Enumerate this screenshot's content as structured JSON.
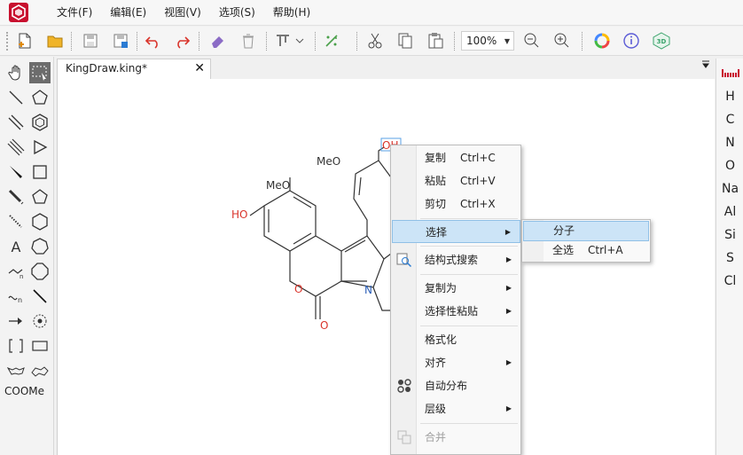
{
  "menubar": {
    "items": [
      "文件(F)",
      "编辑(E)",
      "视图(V)",
      "选项(S)",
      "帮助(H)"
    ]
  },
  "toolbar": {
    "zoom_value": "100%",
    "icons": [
      "new-file",
      "open-folder",
      "save",
      "save-as",
      "undo",
      "redo",
      "eraser",
      "delete",
      "align",
      "clean-structure",
      "cut",
      "copy",
      "paste",
      "zoom-out",
      "zoom-in",
      "color-wheel",
      "info",
      "3d-view"
    ]
  },
  "palette": {
    "template_label": "COOMe"
  },
  "document": {
    "tab_title": "KingDraw.king*",
    "close_glyph": "✕"
  },
  "molecule": {
    "labels": {
      "oh_top": "OH",
      "meo_upper": "MeO",
      "meo_left": "MeO",
      "ho_left": "HO",
      "ring_o": "O",
      "carbonyl_o": "O",
      "nitrogen": "N"
    }
  },
  "elements": [
    "H",
    "C",
    "N",
    "O",
    "Na",
    "Al",
    "Si",
    "S",
    "Cl"
  ],
  "context_menu": {
    "items": [
      {
        "label": "复制",
        "shortcut": "Ctrl+C"
      },
      {
        "label": "粘贴",
        "shortcut": "Ctrl+V"
      },
      {
        "label": "剪切",
        "shortcut": "Ctrl+X"
      },
      {
        "label": "选择",
        "shortcut": ""
      },
      {
        "label": "结构式搜索",
        "shortcut": ""
      },
      {
        "label": "复制为",
        "shortcut": ""
      },
      {
        "label": "选择性粘贴",
        "shortcut": ""
      },
      {
        "label": "格式化",
        "shortcut": ""
      },
      {
        "label": "对齐",
        "shortcut": ""
      },
      {
        "label": "自动分布",
        "shortcut": ""
      },
      {
        "label": "层级",
        "shortcut": ""
      },
      {
        "label": "合并",
        "shortcut": ""
      }
    ],
    "selected": "选择",
    "disabled": "合并"
  },
  "submenu": {
    "items": [
      {
        "label": "分子",
        "shortcut": ""
      },
      {
        "label": "全选",
        "shortcut": "Ctrl+A"
      }
    ],
    "selected": "分子"
  },
  "colors": {
    "accent_red": "#c8102e",
    "heteroatom_red": "#d9342b",
    "nitrogen_blue": "#2b5fb8",
    "menu_highlight": "#cce4f7"
  }
}
